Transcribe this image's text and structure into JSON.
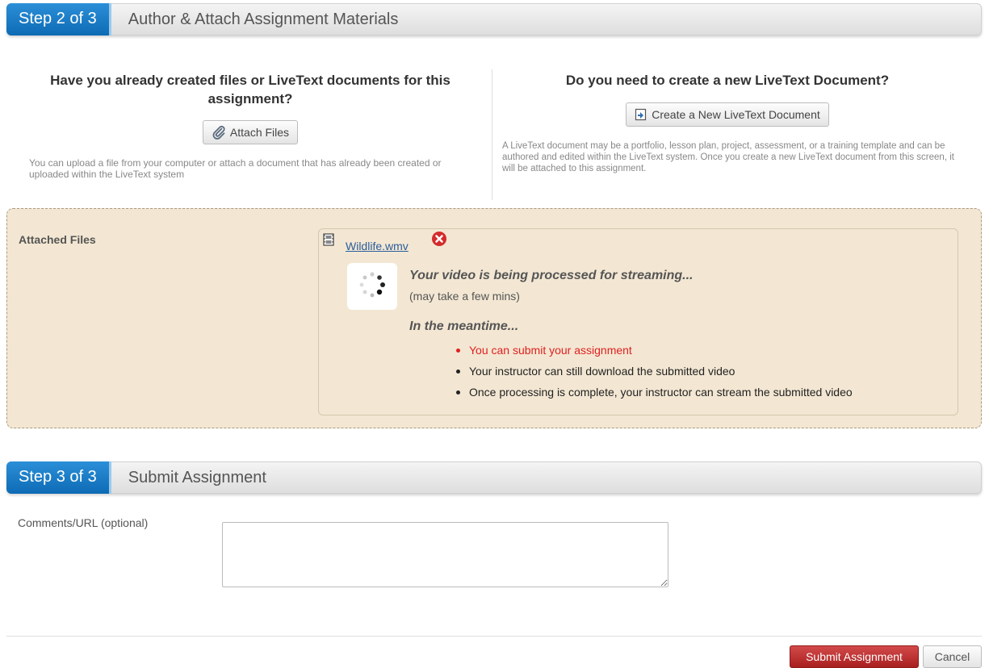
{
  "step2": {
    "badge": "Step 2 of 3",
    "title": "Author & Attach Assignment Materials"
  },
  "left_col": {
    "heading": "Have you already created files or LiveText documents for this assignment?",
    "button_label": "Attach Files",
    "button_icon": "paperclip-icon",
    "description": "You can upload a file from your computer or attach a document that has already been created or uploaded within the LiveText system"
  },
  "right_col": {
    "heading": "Do you need to create a new LiveText Document?",
    "button_label": "Create a New LiveText Document",
    "button_icon": "new-document-icon",
    "description": "A LiveText document may be a portfolio, lesson plan, project, assessment, or a training template and can be authored and edited within the LiveText system. Once you create a new LiveText document from this screen, it will be attached to this assignment."
  },
  "attached": {
    "label": "Attached Files",
    "file_name": "Wildlife.wmv",
    "file_icon": "film-icon",
    "remove_icon": "remove-icon",
    "processing_title": "Your video is being processed for streaming...",
    "processing_sub": "(may take a few mins)",
    "meantime": "In the meantime...",
    "bullets": [
      "You can submit your assignment",
      "Your instructor can still download the submitted video",
      "Once processing is complete, your instructor can stream the submitted video"
    ]
  },
  "step3": {
    "badge": "Step 3 of 3",
    "title": "Submit Assignment",
    "comments_label": "Comments/URL (optional)",
    "comments_value": ""
  },
  "actions": {
    "submit": "Submit Assignment",
    "cancel": "Cancel"
  },
  "colors": {
    "step_badge": "#1576c2",
    "attached_bg": "#f3e7d3",
    "submit_button": "#b82c2c",
    "alert_text": "#e02020",
    "link": "#2a5d9c"
  }
}
